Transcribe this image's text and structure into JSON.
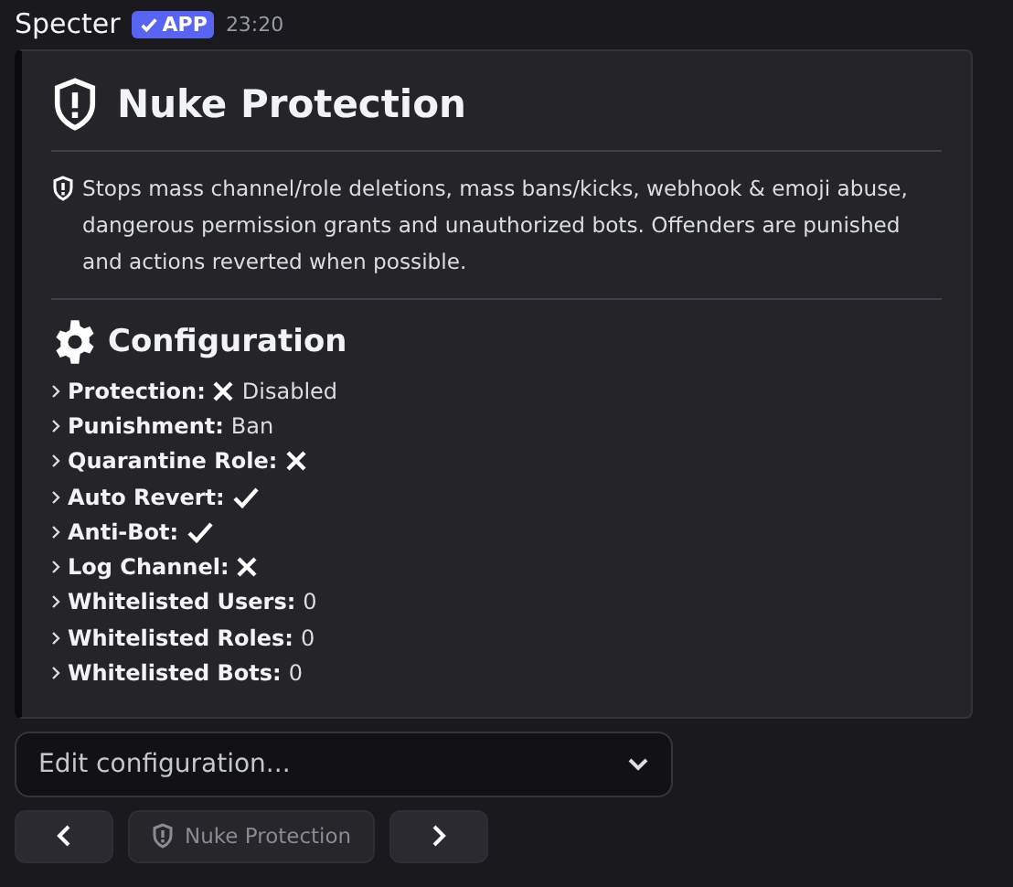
{
  "message": {
    "author": "Specter",
    "badge": "APP",
    "time": "23:20"
  },
  "embed": {
    "title": "Nuke Protection",
    "description": "Stops mass channel/role deletions, mass bans/kicks, webhook & emoji abuse, dangerous permission grants and unauthorized bots. Offenders are punished and actions reverted when possible.",
    "section_title": "Configuration",
    "settings": [
      {
        "label": "Protection:",
        "kind": "cross",
        "value": "Disabled"
      },
      {
        "label": "Punishment:",
        "kind": "text",
        "value": "Ban"
      },
      {
        "label": "Quarantine Role:",
        "kind": "cross"
      },
      {
        "label": "Auto Revert:",
        "kind": "check"
      },
      {
        "label": "Anti-Bot:",
        "kind": "check"
      },
      {
        "label": "Log Channel:",
        "kind": "cross"
      },
      {
        "label": "Whitelisted Users:",
        "kind": "text",
        "value": "0"
      },
      {
        "label": "Whitelisted Roles:",
        "kind": "text",
        "value": "0"
      },
      {
        "label": "Whitelisted Bots:",
        "kind": "text",
        "value": "0"
      }
    ]
  },
  "select": {
    "placeholder": "Edit configuration..."
  },
  "buttons": [
    {
      "kind": "prev",
      "disabled": false
    },
    {
      "kind": "label",
      "label": "Nuke Protection",
      "disabled": true
    },
    {
      "kind": "next",
      "disabled": false
    }
  ]
}
